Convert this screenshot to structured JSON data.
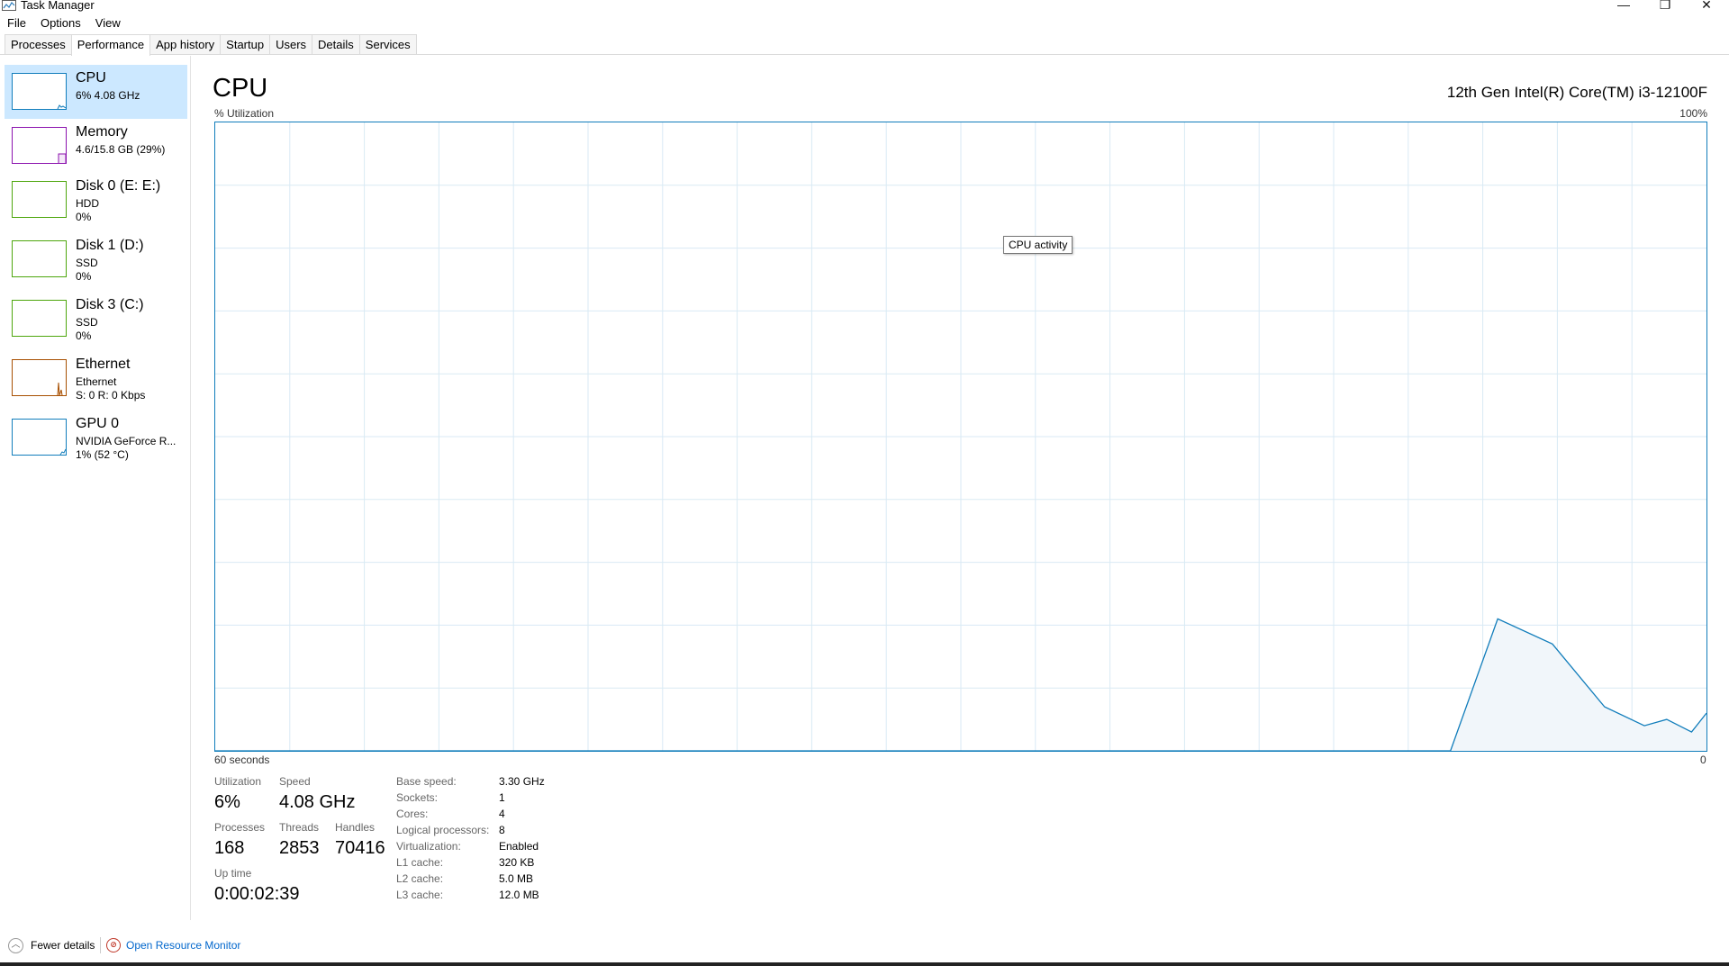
{
  "window": {
    "title": "Task Manager",
    "icon": "task-manager-icon",
    "controls": {
      "minimize": "—",
      "restore": "❐",
      "close": "✕"
    }
  },
  "menu": {
    "items": [
      "File",
      "Options",
      "View"
    ]
  },
  "tabs": {
    "items": [
      "Processes",
      "Performance",
      "App history",
      "Startup",
      "Users",
      "Details",
      "Services"
    ],
    "active": "Performance"
  },
  "sidebar": {
    "items": [
      {
        "name": "CPU",
        "lines": [
          "6% 4.08 GHz"
        ],
        "color": "#117dbb",
        "selected": true
      },
      {
        "name": "Memory",
        "lines": [
          "4.6/15.8 GB (29%)"
        ],
        "color": "#8b12ae",
        "selected": false
      },
      {
        "name": "Disk 0 (E: E:)",
        "lines": [
          "HDD",
          "0%"
        ],
        "color": "#4da60c",
        "selected": false
      },
      {
        "name": "Disk 1 (D:)",
        "lines": [
          "SSD",
          "0%"
        ],
        "color": "#4da60c",
        "selected": false
      },
      {
        "name": "Disk 3 (C:)",
        "lines": [
          "SSD",
          "0%"
        ],
        "color": "#4da60c",
        "selected": false
      },
      {
        "name": "Ethernet",
        "lines": [
          "Ethernet",
          "S: 0 R: 0 Kbps"
        ],
        "color": "#a74f01",
        "selected": false
      },
      {
        "name": "GPU 0",
        "lines": [
          "NVIDIA GeForce R...",
          "1% (52 °C)"
        ],
        "color": "#117dbb",
        "selected": false
      }
    ]
  },
  "main": {
    "title": "CPU",
    "processor": "12th Gen Intel(R) Core(TM) i3-12100F",
    "y_label": "% Utilization",
    "y_max_label": "100%",
    "x_label": "60 seconds",
    "x_min_label": "0",
    "tooltip": "CPU activity"
  },
  "chart_data": {
    "type": "area",
    "x": [
      60,
      10,
      8,
      6,
      4,
      2,
      0
    ],
    "y": [
      0,
      21,
      17,
      7,
      4,
      5,
      3
    ],
    "y_trailing": [
      0,
      0,
      21,
      17,
      7,
      4,
      5,
      3,
      6
    ],
    "x_trailing": [
      60,
      10.3,
      8.4,
      6.2,
      4.1,
      2.5,
      1.6,
      0.6,
      0
    ],
    "ylim": [
      0,
      100
    ],
    "xlim": [
      60,
      0
    ],
    "grid": true,
    "color": "#117dbb",
    "fill": "#f1f6fa"
  },
  "stats": {
    "utilization_label": "Utilization",
    "utilization": "6%",
    "speed_label": "Speed",
    "speed": "4.08 GHz",
    "processes_label": "Processes",
    "processes": "168",
    "threads_label": "Threads",
    "threads": "2853",
    "handles_label": "Handles",
    "handles": "70416",
    "uptime_label": "Up time",
    "uptime": "0:00:02:39"
  },
  "specs": [
    {
      "key": "Base speed:",
      "value": "3.30 GHz"
    },
    {
      "key": "Sockets:",
      "value": "1"
    },
    {
      "key": "Cores:",
      "value": "4"
    },
    {
      "key": "Logical processors:",
      "value": "8"
    },
    {
      "key": "Virtualization:",
      "value": "Enabled"
    },
    {
      "key": "L1 cache:",
      "value": "320 KB"
    },
    {
      "key": "L2 cache:",
      "value": "5.0 MB"
    },
    {
      "key": "L3 cache:",
      "value": "12.0 MB"
    }
  ],
  "footer": {
    "fewer_details": "Fewer details",
    "open_resource_monitor": "Open Resource Monitor"
  }
}
